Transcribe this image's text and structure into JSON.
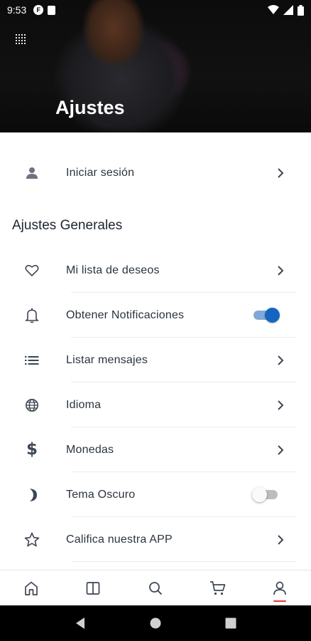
{
  "status_bar": {
    "time": "9:53"
  },
  "header": {
    "title": "Ajustes"
  },
  "login": {
    "label": "Iniciar sesión"
  },
  "section": {
    "title": "Ajustes Generales"
  },
  "items": [
    {
      "label": "Mi lista de deseos",
      "icon": "heart-icon",
      "control": "chevron"
    },
    {
      "label": "Obtener Notificaciones",
      "icon": "bell-icon",
      "control": "toggle",
      "on": true
    },
    {
      "label": "Listar mensajes",
      "icon": "list-icon",
      "control": "chevron"
    },
    {
      "label": "Idioma",
      "icon": "globe-icon",
      "control": "chevron"
    },
    {
      "label": "Monedas",
      "icon": "dollar-icon",
      "control": "chevron"
    },
    {
      "label": "Tema Oscuro",
      "icon": "moon-icon",
      "control": "toggle",
      "on": false
    },
    {
      "label": "Califica nuestra APP",
      "icon": "star-icon",
      "control": "chevron"
    }
  ],
  "bottom_nav": [
    {
      "icon": "home-icon",
      "active": false
    },
    {
      "icon": "book-icon",
      "active": false
    },
    {
      "icon": "search-icon",
      "active": false
    },
    {
      "icon": "cart-icon",
      "active": false
    },
    {
      "icon": "profile-icon",
      "active": true
    }
  ],
  "colors": {
    "accent": "#1565c0",
    "active_indicator": "#e53935",
    "text": "#2b3340"
  }
}
